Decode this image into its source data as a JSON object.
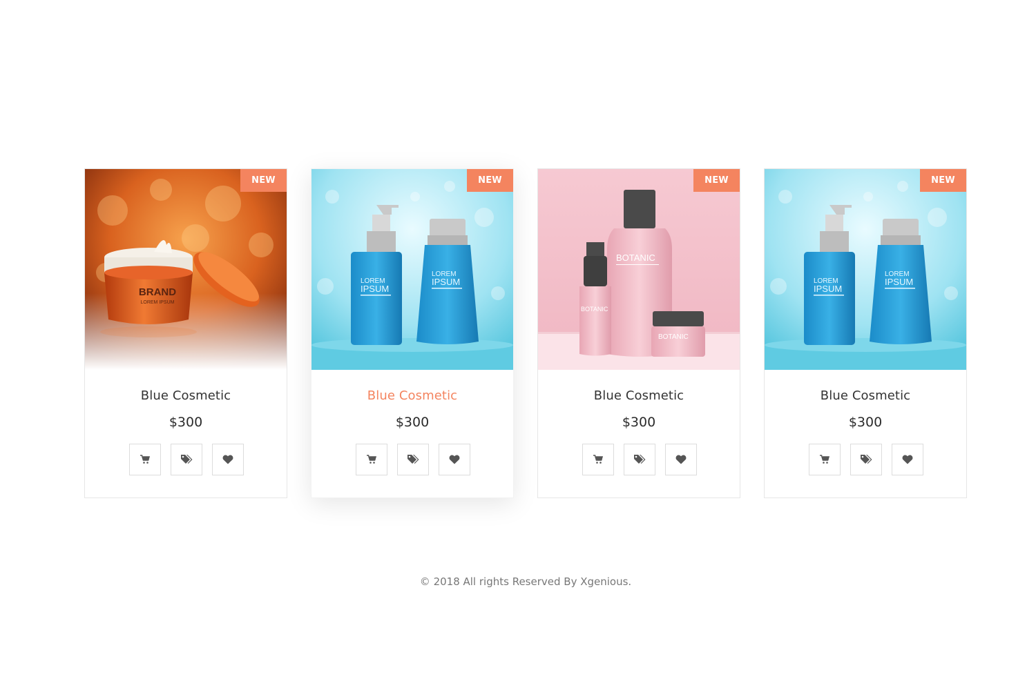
{
  "colors": {
    "accent": "#f4845f",
    "text": "#333333",
    "border": "#e6e6e6"
  },
  "products": [
    {
      "badge": "NEW",
      "title": "Blue Cosmetic",
      "price": "$300",
      "image": "orange-cream-jar",
      "image_text": [
        "BRAND",
        "LOREM IPSUM"
      ]
    },
    {
      "badge": "NEW",
      "title": "Blue Cosmetic",
      "price": "$300",
      "image": "blue-bottles",
      "image_text": [
        "LOREM",
        "IPSUM",
        "LOREM",
        "IPSUM"
      ]
    },
    {
      "badge": "NEW",
      "title": "Blue Cosmetic",
      "price": "$300",
      "image": "pink-botanic-bottles",
      "image_text": [
        "BOTANIC",
        "BOTANIC",
        "BOTANIC"
      ]
    },
    {
      "badge": "NEW",
      "title": "Blue Cosmetic",
      "price": "$300",
      "image": "blue-bottles",
      "image_text": [
        "LOREM",
        "IPSUM",
        "LOREM",
        "IPSUM"
      ]
    }
  ],
  "action_icons": [
    "cart-icon",
    "tags-icon",
    "heart-icon"
  ],
  "footer": {
    "text": "© 2018 All rights Reserved By Xgenious."
  }
}
